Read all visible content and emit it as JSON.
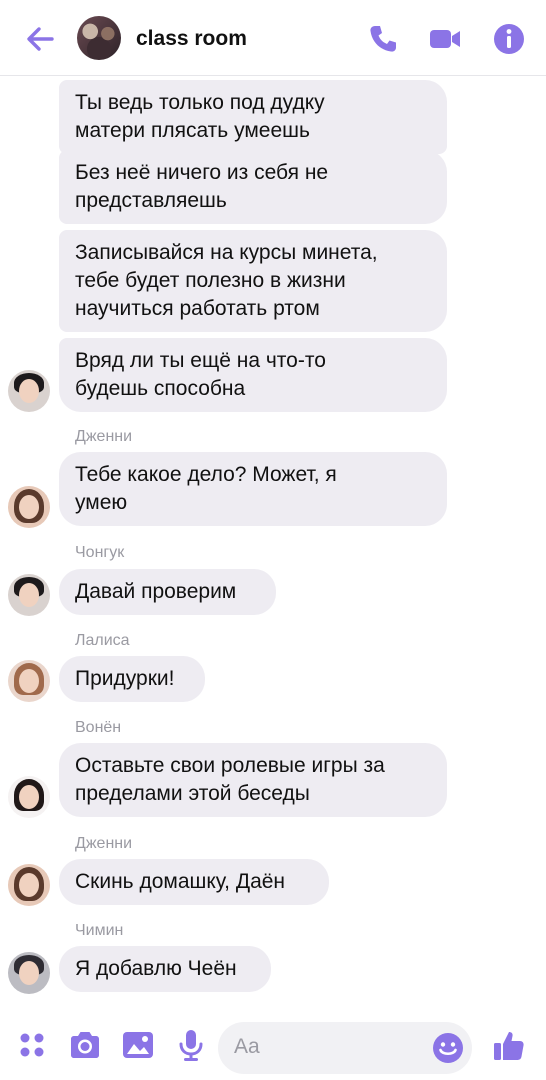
{
  "header": {
    "title": "class room",
    "icons": [
      "back-arrow-icon",
      "phone-icon",
      "video-icon",
      "info-icon"
    ],
    "accent_color": "#8b74e6"
  },
  "messages": [
    {
      "sender": "",
      "text": "Ты ведь только под дудку\nматери плясать умеешь"
    },
    {
      "sender": "",
      "text": "Без неё ничего из себя не\nпредставляешь"
    },
    {
      "sender": "",
      "text": "Записывайся на курсы минета,\nтебе будет полезно в жизни\nнаучиться работать ртом"
    },
    {
      "sender": "",
      "text": "Вряд ли ты ещё на что-то\nбудешь способна"
    },
    {
      "sender": "Дженни",
      "text": "Тебе какое дело? Может, я\nумею"
    },
    {
      "sender": "Чонгук",
      "text": "Давай проверим"
    },
    {
      "sender": "Лалиса",
      "text": "Придурки!"
    },
    {
      "sender": "Вонён",
      "text": "Оставьте свои ролевые игры за\nпределами этой беседы"
    },
    {
      "sender": "Дженни",
      "text": "Скинь домашку, Даён"
    },
    {
      "sender": "Чимин",
      "text": "Я добавлю Чеён"
    }
  ],
  "composer": {
    "placeholder": "Aa",
    "icons": [
      "apps-icon",
      "camera-icon",
      "gallery-icon",
      "microphone-icon",
      "emoji-icon",
      "thumbs-up-icon"
    ]
  }
}
